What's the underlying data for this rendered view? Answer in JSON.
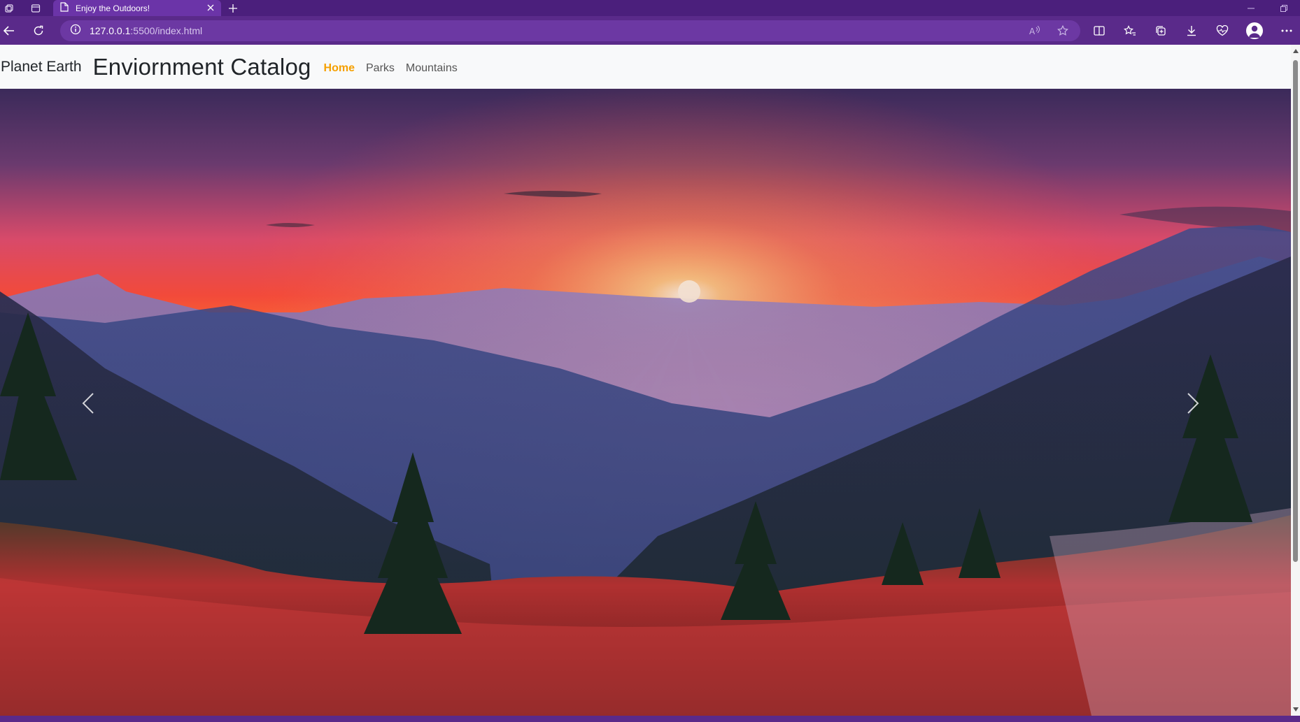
{
  "browser": {
    "tab_title": "Enjoy the Outdoors!",
    "url_host": "127.0.0.1",
    "url_rest": ":5500/index.html",
    "accent": "#5a2a8a"
  },
  "page": {
    "brand_small": "Planet Earth",
    "brand_large": "Enviornment Catalog",
    "nav": [
      {
        "label": "Home",
        "active": true
      },
      {
        "label": "Parks",
        "active": false
      },
      {
        "label": "Mountains",
        "active": false
      }
    ],
    "active_color": "#f5a000",
    "hero_image": "sunset-mountains"
  }
}
